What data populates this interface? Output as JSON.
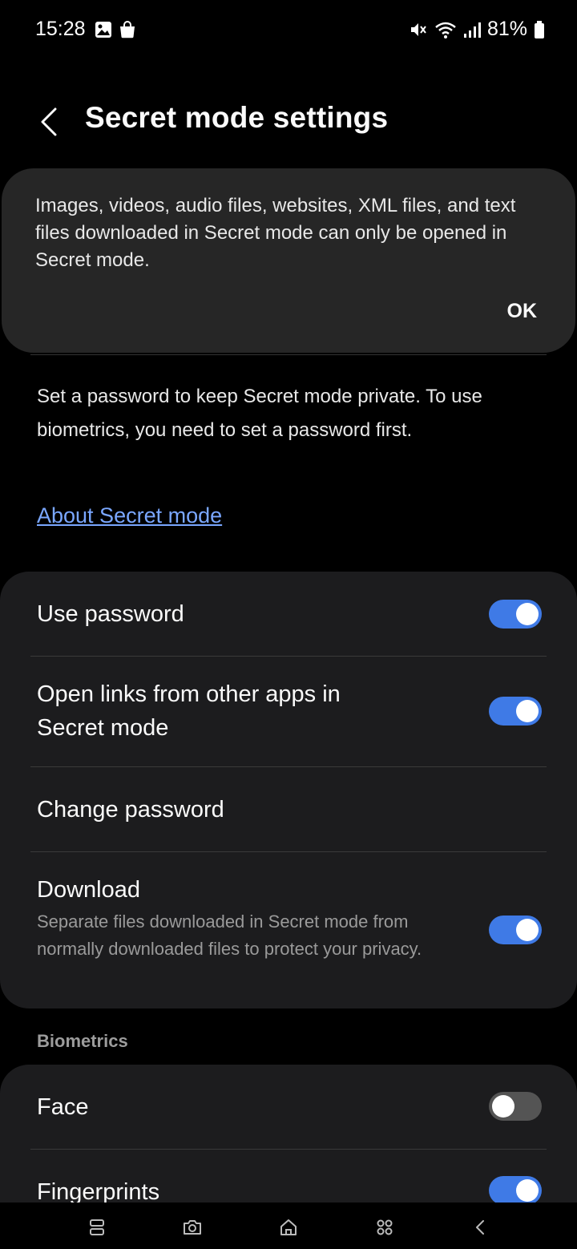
{
  "status": {
    "time": "15:28",
    "battery": "81%"
  },
  "header": {
    "title": "Secret mode settings"
  },
  "info_card": {
    "text": "Images, videos, audio files, websites, XML files, and text files downloaded in Secret mode can only be opened in Secret mode.",
    "ok_label": "OK"
  },
  "description": "Set a password to keep Secret mode private. To use biometrics, you need to set a password first.",
  "about_link": "About Secret mode",
  "settings": {
    "use_password": {
      "title": "Use password",
      "on": true
    },
    "open_links": {
      "title": "Open links from other apps in Secret mode",
      "on": true
    },
    "change_password": {
      "title": "Change password"
    },
    "download": {
      "title": "Download",
      "subtitle": "Separate files downloaded in Secret mode from normally downloaded files to protect your privacy.",
      "on": true
    }
  },
  "biometrics": {
    "header": "Biometrics",
    "face": {
      "title": "Face",
      "on": false
    },
    "fingerprints": {
      "title": "Fingerprints",
      "on": true
    }
  },
  "colors": {
    "accent": "#3f7ae6",
    "link": "#7aa7ff",
    "card": "#1c1c1e"
  }
}
